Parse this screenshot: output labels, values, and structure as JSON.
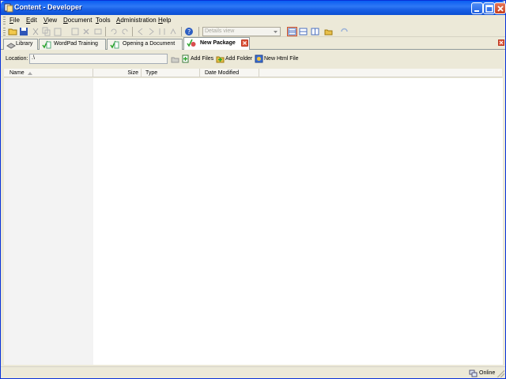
{
  "window": {
    "title": "Content - Developer"
  },
  "menu": [
    {
      "label": "File"
    },
    {
      "label": "Edit"
    },
    {
      "label": "View"
    },
    {
      "label": "Document"
    },
    {
      "label": "Tools"
    },
    {
      "label": "Administration"
    },
    {
      "label": "Help"
    }
  ],
  "toolbar": {
    "view_select": "Details view"
  },
  "tabs": [
    {
      "label": "Library",
      "icon": "library-icon",
      "active": false
    },
    {
      "label": "WordPad Training",
      "icon": "checked-document-icon",
      "active": false
    },
    {
      "label": "Opening a Document",
      "icon": "checked-document-icon",
      "active": false
    },
    {
      "label": "New Package",
      "icon": "checked-package-icon",
      "active": true
    }
  ],
  "location": {
    "label": "Location:",
    "value": ".\\"
  },
  "actions": [
    {
      "label": "Add Files",
      "icon": "add-files-icon"
    },
    {
      "label": "Add Folder",
      "icon": "add-folder-icon"
    },
    {
      "label": "New Html File",
      "icon": "html-file-icon"
    }
  ],
  "columns": [
    {
      "label": "Name"
    },
    {
      "label": "Size"
    },
    {
      "label": "Type"
    },
    {
      "label": "Date Modified"
    }
  ],
  "status": {
    "text": "Online"
  },
  "colors": {
    "titlebar": "#0a5ef2",
    "close_button": "#e0553b",
    "face": "#ece9d8"
  }
}
